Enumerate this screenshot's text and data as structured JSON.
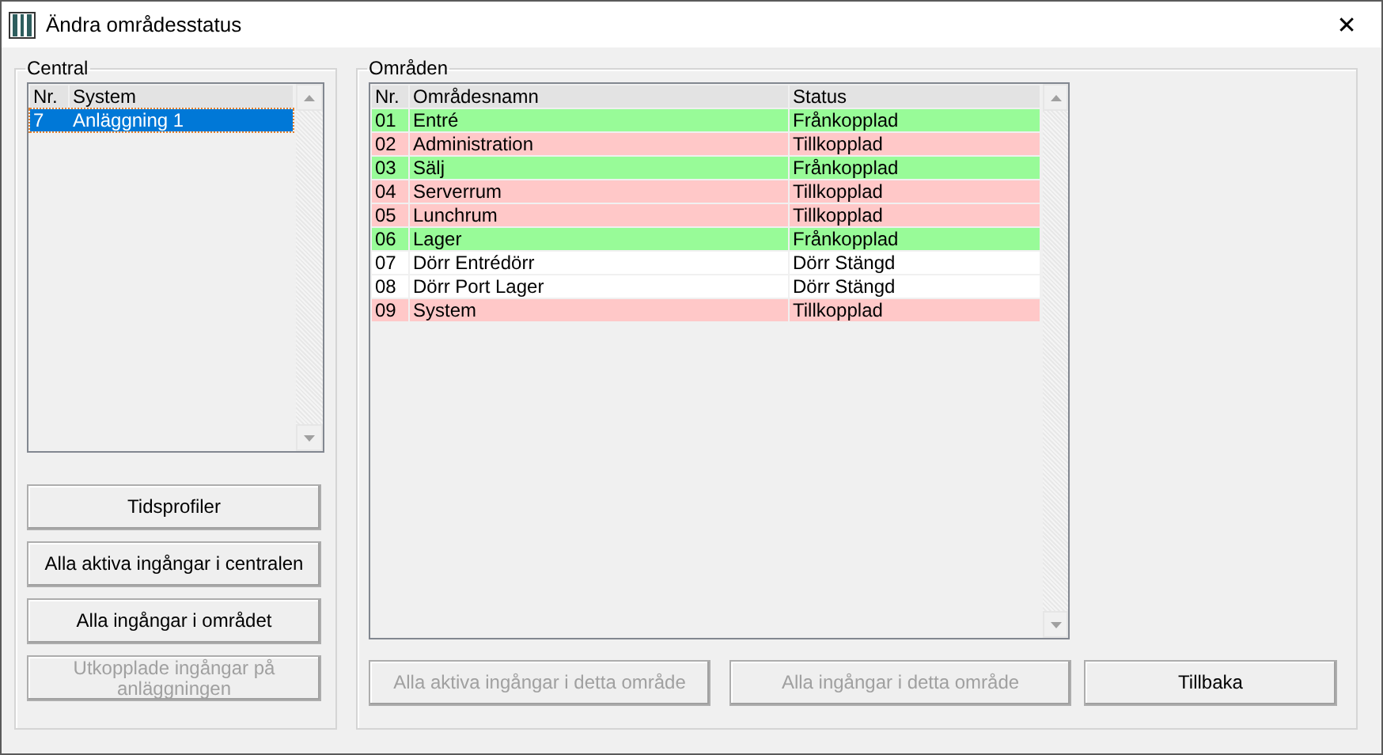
{
  "window": {
    "title": "Ändra områdesstatus",
    "close": "✕"
  },
  "central": {
    "legend": "Central",
    "columns": [
      "Nr.",
      "System"
    ],
    "rows": [
      {
        "nr": "7",
        "system": "Anläggning 1",
        "selected": true
      }
    ],
    "buttons": [
      {
        "label": "Tidsprofiler",
        "disabled": false
      },
      {
        "label": "Alla aktiva ingångar i centralen",
        "disabled": false
      },
      {
        "label": "Alla ingångar i området",
        "disabled": false
      },
      {
        "label": "Utkopplade ingångar på anläggningen",
        "disabled": true
      }
    ]
  },
  "areas": {
    "legend": "Områden",
    "columns": [
      "Nr.",
      "Områdesnamn",
      "Status"
    ],
    "rows": [
      {
        "nr": "01",
        "name": "Entré",
        "status": "Frånkopplad",
        "color": "#98fb98"
      },
      {
        "nr": "02",
        "name": "Administration",
        "status": "Tillkopplad",
        "color": "#ffc8c8"
      },
      {
        "nr": "03",
        "name": "Sälj",
        "status": "Frånkopplad",
        "color": "#98fb98"
      },
      {
        "nr": "04",
        "name": "Serverrum",
        "status": "Tillkopplad",
        "color": "#ffc8c8"
      },
      {
        "nr": "05",
        "name": "Lunchrum",
        "status": "Tillkopplad",
        "color": "#ffc8c8"
      },
      {
        "nr": "06",
        "name": "Lager",
        "status": "Frånkopplad",
        "color": "#98fb98"
      },
      {
        "nr": "07",
        "name": "Dörr Entrédörr",
        "status": "Dörr Stängd",
        "color": "#ffffff"
      },
      {
        "nr": "08",
        "name": "Dörr Port Lager",
        "status": "Dörr Stängd",
        "color": "#ffffff"
      },
      {
        "nr": "09",
        "name": "System",
        "status": "Tillkopplad",
        "color": "#ffc8c8"
      }
    ],
    "buttons": [
      {
        "label": "Alla aktiva ingångar i detta område",
        "disabled": true
      },
      {
        "label": "Alla ingångar i detta område",
        "disabled": true
      },
      {
        "label": "Tillbaka",
        "disabled": false
      }
    ]
  }
}
